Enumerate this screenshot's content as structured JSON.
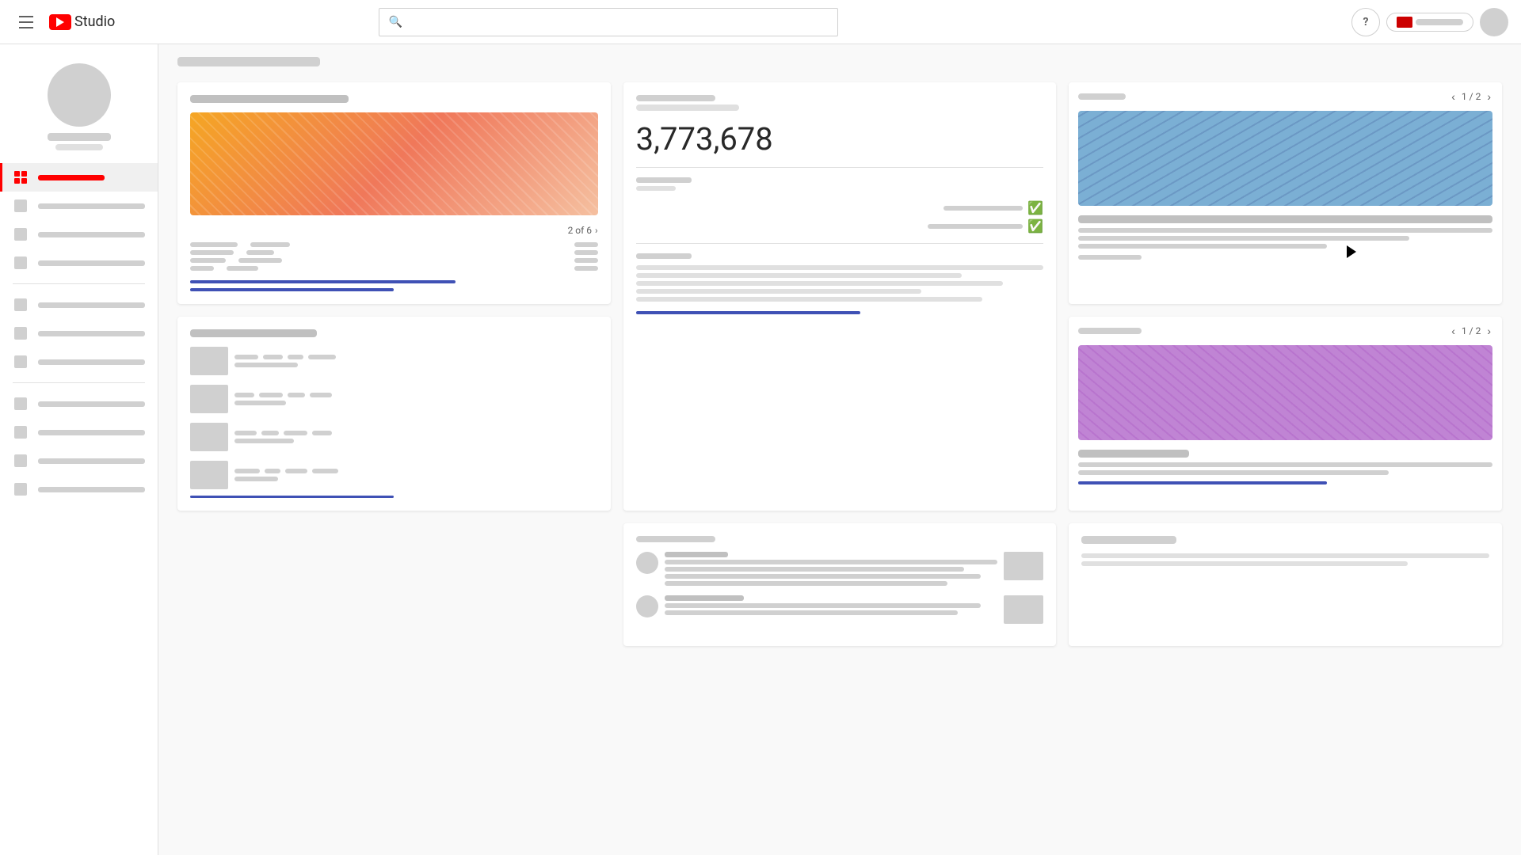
{
  "header": {
    "logo_text": "Studio",
    "search_placeholder": "──────────────",
    "help_label": "?",
    "pagination_1": "1 / 2",
    "pagination_2": "1 / 2"
  },
  "sidebar": {
    "items": [
      {
        "label": "Dashboard",
        "active": true
      },
      {
        "label": ""
      },
      {
        "label": ""
      },
      {
        "label": ""
      },
      {
        "label": ""
      },
      {
        "label": ""
      },
      {
        "label": ""
      },
      {
        "label": ""
      },
      {
        "label": ""
      },
      {
        "label": ""
      },
      {
        "label": ""
      }
    ]
  },
  "content": {
    "title": "──────────",
    "card1": {
      "badge": "2 of 6"
    },
    "card4": {
      "big_number": "3,773,678",
      "label1": "──────────",
      "label2": "──────────────"
    },
    "card3": {
      "pagination": "1 / 2"
    },
    "card6": {
      "pagination": "1 / 2"
    }
  }
}
